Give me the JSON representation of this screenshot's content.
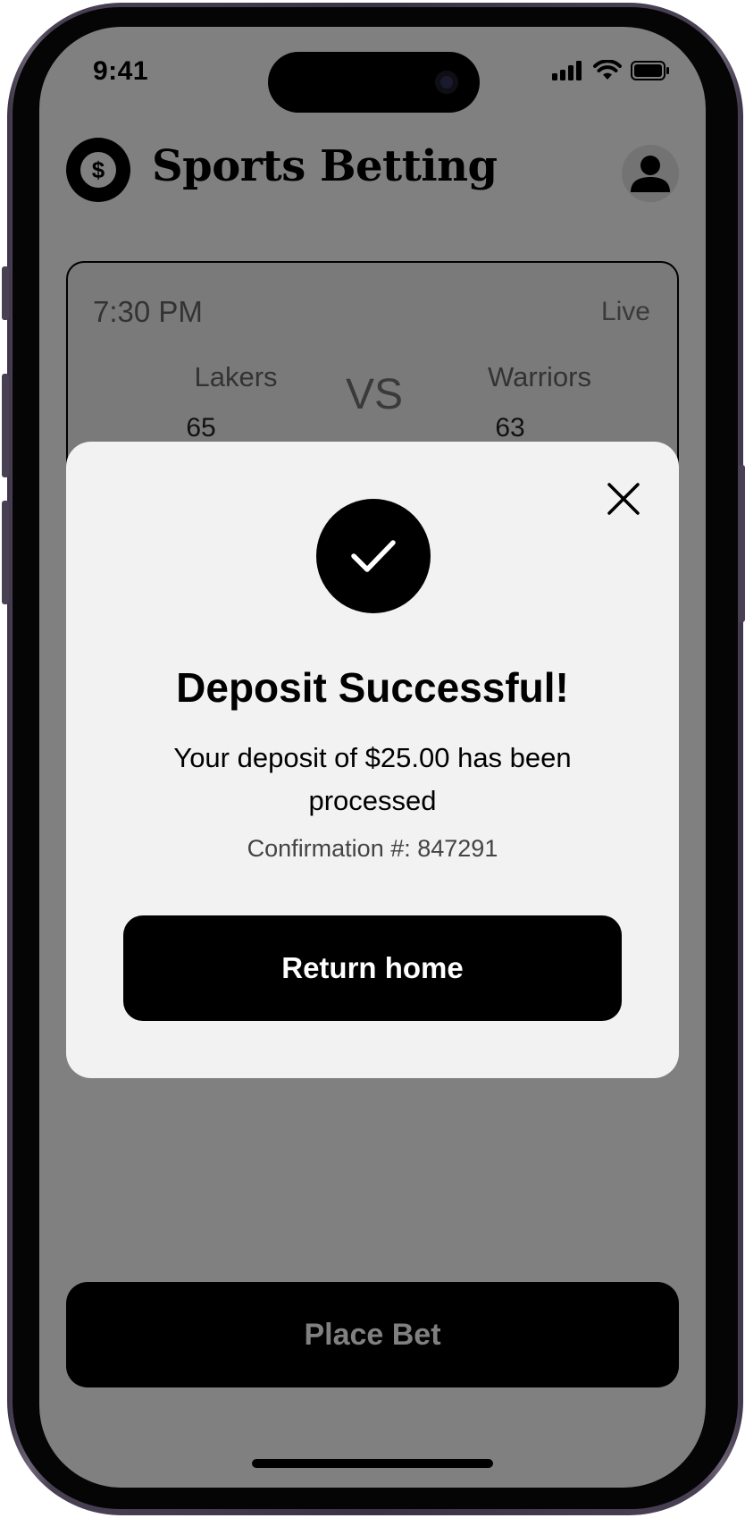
{
  "status_bar": {
    "time": "9:41"
  },
  "header": {
    "title": "Sports Betting",
    "logo_glyph": "$",
    "logo_icon": "dollar-coin-icon",
    "profile_icon": "user-icon"
  },
  "game": {
    "time": "7:30 PM",
    "status": "Live",
    "vs_label": "VS",
    "home": {
      "name": "Lakers",
      "score": "65"
    },
    "away": {
      "name": "Warriors",
      "score": "63"
    }
  },
  "modal": {
    "title": "Deposit Successful!",
    "message": "Your deposit of $25.00 has been processed",
    "confirmation": "Confirmation #: 847291",
    "button_label": "Return home",
    "icons": {
      "success": "checkmark-icon",
      "close": "close-icon"
    }
  },
  "footer": {
    "place_bet_label": "Place Bet"
  },
  "colors": {
    "overlay_gray": "#808080",
    "modal_bg": "#f2f2f2",
    "primary": "#000000",
    "disabled_text": "#808080"
  }
}
